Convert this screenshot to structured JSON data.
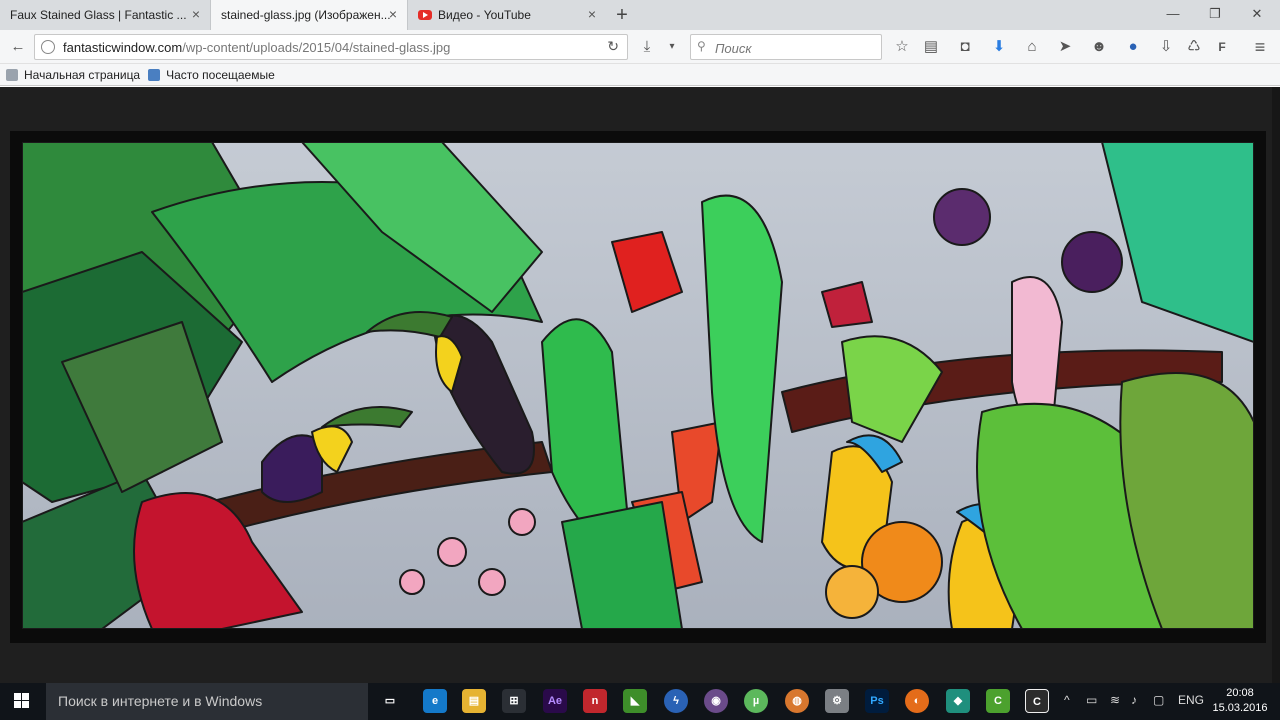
{
  "browser": {
    "tabs": [
      {
        "title": "Faux Stained Glass | Fantastic ...",
        "active": false
      },
      {
        "title": "stained-glass.jpg (Изображен...",
        "active": true
      },
      {
        "title": "Видео - YouTube",
        "active": false
      }
    ],
    "new_tab_label": "+",
    "window_controls": {
      "minimize": "—",
      "maximize": "❐",
      "close": "✕"
    }
  },
  "nav": {
    "url_host": "fantasticwindow.com",
    "url_path": "/wp-content/uploads/2015/04/stained-glass.jpg",
    "search_placeholder": "Поиск",
    "search_icon": "magnifier-icon"
  },
  "bookmarks": [
    {
      "label": "Начальная страница"
    },
    {
      "label": "Часто посещаемые"
    }
  ],
  "image": {
    "alt": "stained-glass.jpg",
    "background_color": "#1f1f1f",
    "sky_color": "#b9bfca"
  },
  "taskbar": {
    "search_placeholder": "Поиск в интернете и в Windows",
    "lang": "ENG",
    "time": "20:08",
    "date": "15.03.2016",
    "apps": [
      {
        "name": "task-view-icon",
        "label": "▭",
        "color": "#101419"
      },
      {
        "name": "edge-icon",
        "label": "e",
        "color": "#1479c9"
      },
      {
        "name": "file-explorer-icon",
        "label": "▤",
        "color": "#e6b332"
      },
      {
        "name": "store-icon",
        "label": "⊞",
        "color": "#2b2f35"
      },
      {
        "name": "after-effects-icon",
        "label": "Ae",
        "color": "#2a0a4a"
      },
      {
        "name": "nero-icon",
        "label": "n",
        "color": "#c1272d"
      },
      {
        "name": "nvidia-icon",
        "label": "◣",
        "color": "#3e8e2a"
      },
      {
        "name": "flash-icon",
        "label": "ϟ",
        "color": "#2a62b5"
      },
      {
        "name": "disc-icon",
        "label": "◉",
        "color": "#6b4b8a"
      },
      {
        "name": "utorrent-icon",
        "label": "µ",
        "color": "#5cb85c"
      },
      {
        "name": "app-orange-icon",
        "label": "◍",
        "color": "#d8772e"
      },
      {
        "name": "app-gray-icon",
        "label": "⚙",
        "color": "#7b7f84"
      },
      {
        "name": "photoshop-icon",
        "label": "Ps",
        "color": "#001c3d"
      },
      {
        "name": "firefox-icon",
        "label": "◐",
        "color": "#e46c1a"
      },
      {
        "name": "app-teal-icon",
        "label": "◆",
        "color": "#1f8f7d"
      },
      {
        "name": "camtasia-icon",
        "label": "C",
        "color": "#4ca12e"
      },
      {
        "name": "camtasia-recorder-icon",
        "label": "C",
        "color": "#2c2c2c"
      }
    ]
  }
}
